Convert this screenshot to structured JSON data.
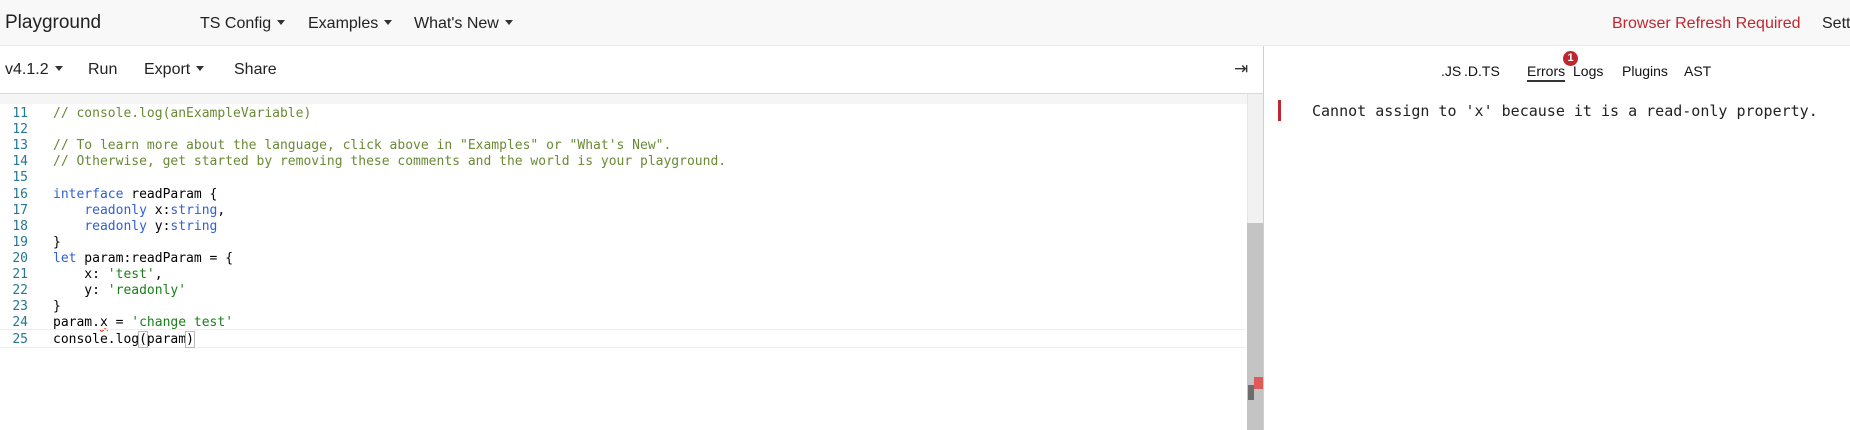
{
  "topnav": {
    "brand": "Playground",
    "ts_config": "TS Config",
    "examples": "Examples",
    "whats_new": "What's New",
    "refresh_notice": "Browser Refresh Required",
    "settings": "Sett"
  },
  "toolbar": {
    "version": "v4.1.2",
    "run": "Run",
    "export": "Export",
    "share": "Share",
    "collapse_icon": "⇥"
  },
  "editor": {
    "lines": [
      {
        "num": "11",
        "tokens": [
          {
            "t": "// console.log(anExampleVariable)",
            "c": "comment"
          }
        ]
      },
      {
        "num": "12",
        "tokens": []
      },
      {
        "num": "13",
        "tokens": [
          {
            "t": "// To learn more about the language, click above in \"Examples\" or \"What's New\".",
            "c": "comment"
          }
        ]
      },
      {
        "num": "14",
        "tokens": [
          {
            "t": "// Otherwise, get started by removing these comments and the world is your playground.",
            "c": "comment"
          }
        ]
      },
      {
        "num": "15",
        "tokens": []
      },
      {
        "num": "16",
        "tokens": [
          {
            "t": "interface",
            "c": "keyword"
          },
          {
            "t": " readParam {",
            "c": ""
          }
        ]
      },
      {
        "num": "17",
        "tokens": [
          {
            "t": "    ",
            "c": ""
          },
          {
            "t": "readonly",
            "c": "keyword"
          },
          {
            "t": " x:",
            "c": ""
          },
          {
            "t": "string",
            "c": "type"
          },
          {
            "t": ",",
            "c": ""
          }
        ]
      },
      {
        "num": "18",
        "tokens": [
          {
            "t": "    ",
            "c": ""
          },
          {
            "t": "readonly",
            "c": "keyword"
          },
          {
            "t": " y:",
            "c": ""
          },
          {
            "t": "string",
            "c": "type"
          }
        ]
      },
      {
        "num": "19",
        "tokens": [
          {
            "t": "}",
            "c": ""
          }
        ]
      },
      {
        "num": "20",
        "tokens": [
          {
            "t": "let",
            "c": "keyword"
          },
          {
            "t": " param:readParam = {",
            "c": ""
          }
        ]
      },
      {
        "num": "21",
        "tokens": [
          {
            "t": "    x: ",
            "c": ""
          },
          {
            "t": "'test'",
            "c": "string"
          },
          {
            "t": ",",
            "c": ""
          }
        ]
      },
      {
        "num": "22",
        "tokens": [
          {
            "t": "    y: ",
            "c": ""
          },
          {
            "t": "'readonly'",
            "c": "string"
          }
        ]
      },
      {
        "num": "23",
        "tokens": [
          {
            "t": "}",
            "c": ""
          }
        ]
      },
      {
        "num": "24",
        "tokens": [
          {
            "t": "param.",
            "c": ""
          },
          {
            "t": "x",
            "c": "error"
          },
          {
            "t": " = ",
            "c": ""
          },
          {
            "t": "'change test'",
            "c": "string"
          }
        ]
      },
      {
        "num": "25",
        "tokens": [
          {
            "t": "console.log",
            "c": ""
          },
          {
            "t": "(",
            "c": "bracket"
          },
          {
            "t": "param",
            "c": ""
          },
          {
            "t": ")",
            "c": "bracket"
          }
        ],
        "current": true
      }
    ]
  },
  "sidebar": {
    "tabs": [
      {
        "label": ".JS",
        "active": false
      },
      {
        "label": ".D.TS",
        "active": false
      },
      {
        "label": "Errors",
        "active": true
      },
      {
        "label": "Logs",
        "active": false
      },
      {
        "label": "Plugins",
        "active": false
      },
      {
        "label": "AST",
        "active": false
      }
    ],
    "error_count": "1",
    "error_message": "Cannot assign to 'x' because it is a read-only property."
  },
  "colors": {
    "error": "#c0262f",
    "keyword": "#2f5fd8",
    "string": "#1a7f1a",
    "comment": "#6a8a35",
    "line_number": "#237893"
  }
}
